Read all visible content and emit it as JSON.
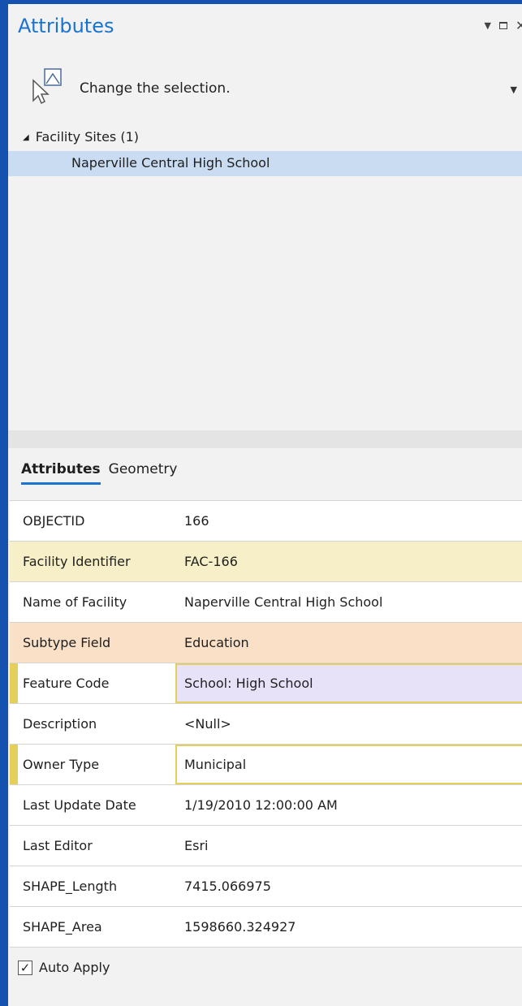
{
  "pane": {
    "title": "Attributes"
  },
  "selection": {
    "change_label": "Change the selection.",
    "icons": {
      "select": "select-features-icon",
      "dropdown": "dropdown-arrow-icon"
    }
  },
  "tree": {
    "group_label": "Facility Sites (1)",
    "selected_item": "Naperville Central High School"
  },
  "tabs": {
    "attributes": "Attributes",
    "geometry": "Geometry"
  },
  "rows": [
    {
      "key": "OBJECTID",
      "value": "166"
    },
    {
      "key": "Facility Identifier",
      "value": "FAC-166"
    },
    {
      "key": "Name of Facility",
      "value": "Naperville Central High School"
    },
    {
      "key": "Subtype Field",
      "value": "Education"
    },
    {
      "key": "Feature Code",
      "value": "School: High School"
    },
    {
      "key": "Description",
      "value": "<Null>"
    },
    {
      "key": "Owner Type",
      "value": "Municipal"
    },
    {
      "key": "Last Update Date",
      "value": "1/19/2010 12:00:00 AM"
    },
    {
      "key": "Last Editor",
      "value": "Esri"
    },
    {
      "key": "SHAPE_Length",
      "value": "7415.066975"
    },
    {
      "key": "SHAPE_Area",
      "value": "1598660.324927"
    }
  ],
  "footer": {
    "auto_apply_label": "Auto Apply",
    "auto_apply_checked": true
  },
  "colors": {
    "frame": "#1552b0",
    "title": "#1b73d1",
    "selected_tree_item": "#c9dcf2",
    "required_row": "#f6efc7",
    "subtype_row": "#fae0c7",
    "domain_cell": "#e8e2f8",
    "edit_highlight": "#e3cf5a"
  }
}
